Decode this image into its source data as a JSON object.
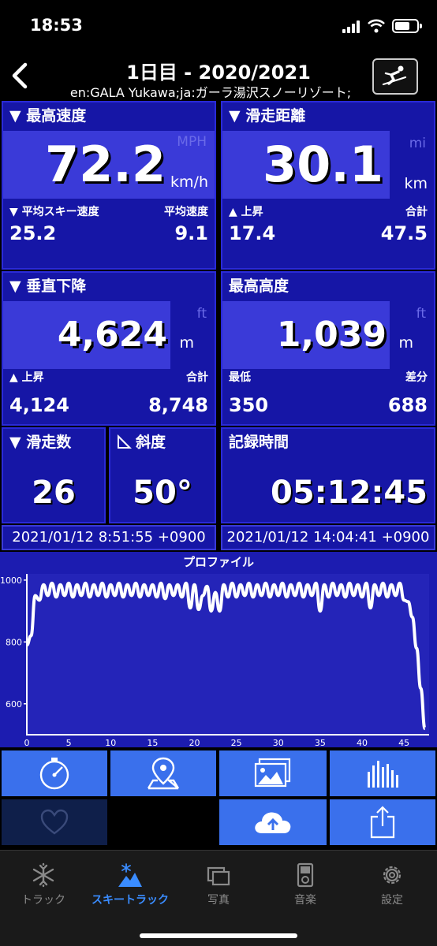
{
  "status": {
    "time": "18:53"
  },
  "header": {
    "title": "1日目 - 2020/2021",
    "subtitle": "en:GALA Yukawa;ja:ガーラ湯沢スノーリゾート;"
  },
  "max_speed": {
    "title": "▼ 最高速度",
    "value": "72.2",
    "unit_alt": "MPH",
    "unit": "km/h",
    "left_label": "▼ 平均スキー速度",
    "left_value": "25.2",
    "right_label": "平均速度",
    "right_value": "9.1"
  },
  "distance": {
    "title": "▼ 滑走距離",
    "value": "30.1",
    "unit_alt": "mi",
    "unit": "km",
    "left_label": "▲ 上昇",
    "left_value": "17.4",
    "right_label": "合計",
    "right_value": "47.5"
  },
  "vertical": {
    "title": "▼ 垂直下降",
    "value": "4,624",
    "unit_alt": "ft",
    "unit": "m",
    "left_label": "▲ 上昇",
    "left_value": "4,124",
    "right_label": "合計",
    "right_value": "8,748"
  },
  "altitude": {
    "title": "最高高度",
    "value": "1,039",
    "unit_alt": "ft",
    "unit": "m",
    "left_label": "最低",
    "left_value": "350",
    "right_label": "差分",
    "right_value": "688"
  },
  "runs": {
    "title": "▼ 滑走数",
    "value": "26"
  },
  "slope": {
    "title": "斜度",
    "value": "50°"
  },
  "record_time": {
    "title": "記録時間",
    "value": "05:12:45"
  },
  "start_time": "2021/01/12 8:51:55 +0900",
  "end_time": "2021/01/12 14:04:41 +0900",
  "chart_data": {
    "type": "line",
    "title": "プロファイル",
    "xlabel": "",
    "ylabel": "",
    "x_ticks": [
      "0",
      "5",
      "10",
      "15",
      "20",
      "25",
      "30",
      "35",
      "40",
      "45"
    ],
    "y_ticks": [
      "600",
      "800",
      "1000"
    ],
    "xlim": [
      0,
      48
    ],
    "ylim": [
      500,
      1020
    ],
    "series": [
      {
        "values": [
          [
            0,
            790
          ],
          [
            0.5,
            820
          ],
          [
            1,
            950
          ],
          [
            1.5,
            935
          ],
          [
            2,
            985
          ],
          [
            2.5,
            950
          ],
          [
            3,
            990
          ],
          [
            3.5,
            945
          ],
          [
            4,
            985
          ],
          [
            4.5,
            950
          ],
          [
            5,
            990
          ],
          [
            5.5,
            945
          ],
          [
            6,
            985
          ],
          [
            6.5,
            950
          ],
          [
            7,
            990
          ],
          [
            7.5,
            945
          ],
          [
            8,
            985
          ],
          [
            8.5,
            950
          ],
          [
            9,
            990
          ],
          [
            9.5,
            945
          ],
          [
            10,
            985
          ],
          [
            10.5,
            950
          ],
          [
            11,
            990
          ],
          [
            11.5,
            945
          ],
          [
            12,
            985
          ],
          [
            12.5,
            950
          ],
          [
            13,
            990
          ],
          [
            13.5,
            945
          ],
          [
            14,
            985
          ],
          [
            14.5,
            950
          ],
          [
            15,
            985
          ],
          [
            15.5,
            945
          ],
          [
            16,
            990
          ],
          [
            16.5,
            940
          ],
          [
            17,
            985
          ],
          [
            17.5,
            950
          ],
          [
            18,
            985
          ],
          [
            18.5,
            945
          ],
          [
            19,
            990
          ],
          [
            19.5,
            910
          ],
          [
            20,
            985
          ],
          [
            20.5,
            905
          ],
          [
            21,
            950
          ],
          [
            21.5,
            980
          ],
          [
            22,
            900
          ],
          [
            22.5,
            960
          ],
          [
            23,
            900
          ],
          [
            23.5,
            985
          ],
          [
            24,
            945
          ],
          [
            24.5,
            990
          ],
          [
            25,
            945
          ],
          [
            25.5,
            985
          ],
          [
            26,
            950
          ],
          [
            26.5,
            990
          ],
          [
            27,
            945
          ],
          [
            27.5,
            985
          ],
          [
            28,
            950
          ],
          [
            28.5,
            990
          ],
          [
            29,
            945
          ],
          [
            29.5,
            985
          ],
          [
            30,
            950
          ],
          [
            30.5,
            990
          ],
          [
            31,
            945
          ],
          [
            31.5,
            985
          ],
          [
            32,
            950
          ],
          [
            32.5,
            990
          ],
          [
            33,
            945
          ],
          [
            33.5,
            985
          ],
          [
            34,
            950
          ],
          [
            34.5,
            990
          ],
          [
            35,
            900
          ],
          [
            35.5,
            985
          ],
          [
            36,
            945
          ],
          [
            36.5,
            990
          ],
          [
            37,
            950
          ],
          [
            37.5,
            985
          ],
          [
            38,
            945
          ],
          [
            38.5,
            990
          ],
          [
            39,
            950
          ],
          [
            39.5,
            985
          ],
          [
            40,
            945
          ],
          [
            40.5,
            990
          ],
          [
            41,
            910
          ],
          [
            41.5,
            985
          ],
          [
            42,
            950
          ],
          [
            42.5,
            990
          ],
          [
            43,
            945
          ],
          [
            43.5,
            985
          ],
          [
            44,
            950
          ],
          [
            44.5,
            990
          ],
          [
            45,
            935
          ],
          [
            45.5,
            930
          ],
          [
            46,
            880
          ],
          [
            46.5,
            780
          ],
          [
            47,
            650
          ],
          [
            47.5,
            520
          ]
        ]
      }
    ]
  }
}
